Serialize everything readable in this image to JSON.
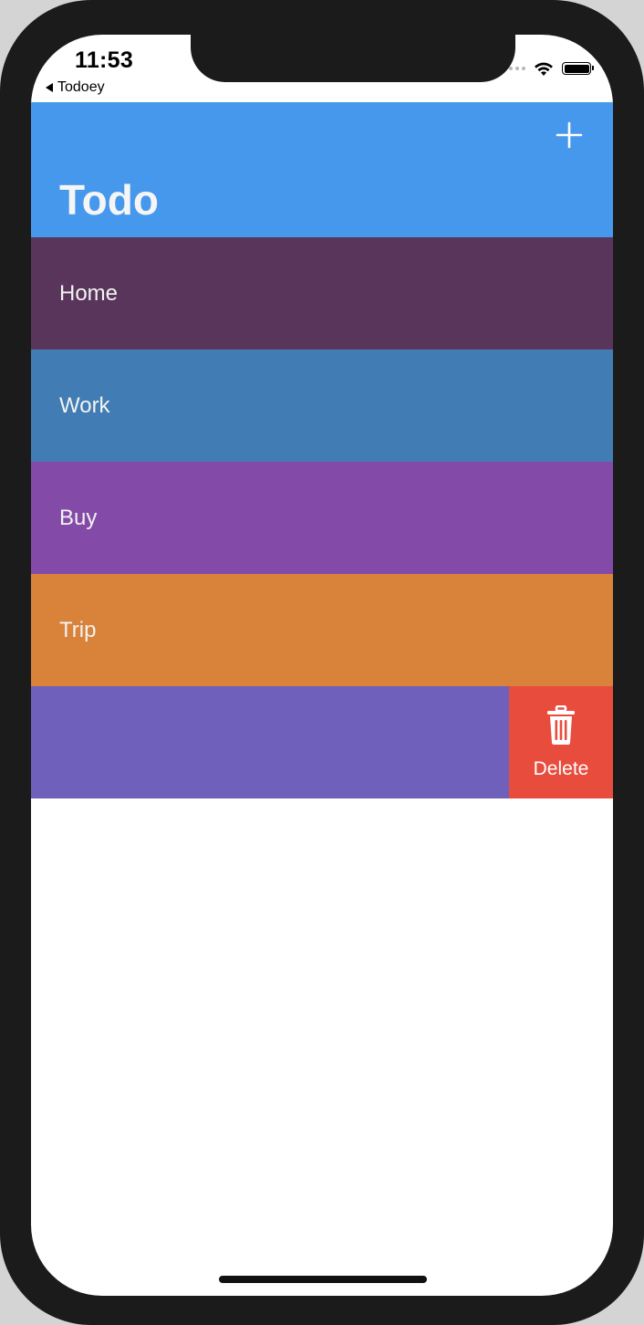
{
  "status_bar": {
    "time": "11:53",
    "back_app": "Todoey"
  },
  "navbar": {
    "title": "Todo",
    "color": "#4698ec",
    "add_icon": "plus-icon"
  },
  "categories": [
    {
      "label": "Home",
      "color": "#59355b"
    },
    {
      "label": "Work",
      "color": "#417db4"
    },
    {
      "label": "Buy",
      "color": "#834ba7"
    },
    {
      "label": "Trip",
      "color": "#d9823a"
    },
    {
      "label": "",
      "color": "#6f60bb"
    }
  ],
  "swipe_action": {
    "label": "Delete",
    "icon": "trash-icon",
    "color": "#e84c3d"
  }
}
